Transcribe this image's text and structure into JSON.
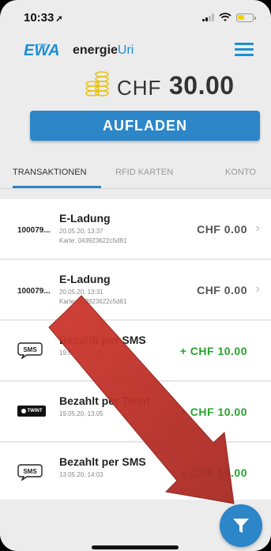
{
  "status_bar": {
    "time": "10:33",
    "location_icon": "location-arrow-icon"
  },
  "header": {
    "brand_prefix": "energie",
    "brand_accent": "Uri",
    "menu_icon": "hamburger-menu-icon",
    "currency": "CHF",
    "balance": "30.00",
    "topup_label": "AUFLADEN"
  },
  "tabs": [
    {
      "label": "TRANSAKTIONEN",
      "active": true
    },
    {
      "label": "RFID KARTEN",
      "active": false
    },
    {
      "label": "KONTO",
      "active": false
    }
  ],
  "transactions": [
    {
      "lead": "100079...",
      "title": "E-Ladung",
      "date": "20.05.20, 13:37",
      "card": "Karte: 043923622c5d81",
      "amount": "CHF  0.00",
      "has_chevron": true
    },
    {
      "lead": "100079...",
      "title": "E-Ladung",
      "date": "20.05.20, 13:31",
      "card": "Karte: 043923622c5d81",
      "amount": "CHF  0.00",
      "has_chevron": true
    },
    {
      "lead_icon": "sms-icon",
      "title": "Bezahlt per SMS",
      "date": "19.05.20, 13:06",
      "amount": "+ CHF  10.00",
      "has_chevron": false
    },
    {
      "lead_icon": "twint-icon",
      "lead_badge": "TWINT",
      "title": "Bezahlt per Twint",
      "date": "19.05.20, 13:05",
      "amount": "+ CHF  10.00",
      "has_chevron": false
    },
    {
      "lead_icon": "sms-icon",
      "title": "Bezahlt per SMS",
      "date": "13.05.20, 14:03",
      "amount": "+ CHF  10.00",
      "has_chevron": false
    }
  ],
  "fab_icon": "filter-icon",
  "colors": {
    "accent": "#2c86c8",
    "positive": "#26a42e",
    "annotation_arrow": "#c0332b"
  }
}
